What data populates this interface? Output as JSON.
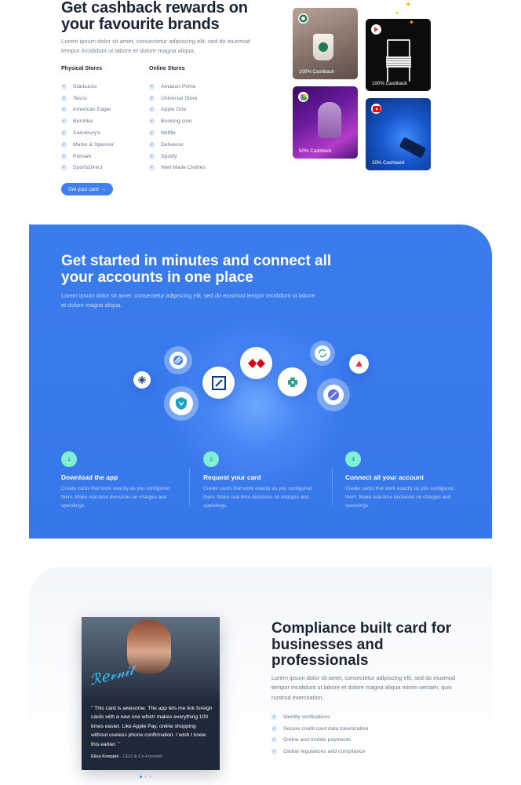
{
  "cashback": {
    "title": "Get cashback rewards on your favourite brands",
    "description": "Lorem ipsum dolor sit amet, consectetur adipiscing elit, sed do eiusmod tempor incididunt ut labore et dolore magna aliqua.",
    "physical_heading": "Physical Stores",
    "online_heading": "Online Stores",
    "physical_stores": [
      "Starbucks",
      "Tesco",
      "American Eagle",
      "Bershka",
      "Sainsbury's",
      "Marks & Spencer",
      "Primark",
      "SportsDirect"
    ],
    "online_stores": [
      "Amazon Prime",
      "Universal Store",
      "Apple One",
      "Booking.com",
      "Netflix",
      "Deliveroo",
      "Spotify",
      "Well Made Clothes"
    ],
    "button_label": "Get your card",
    "button_arrow": "→",
    "tiles": [
      {
        "caption": "100% Cashback",
        "icon": "starbucks-logo-icon"
      },
      {
        "caption": "100% Cashback",
        "icon": "brand-flag-logo-icon"
      },
      {
        "caption": "50% Cashback",
        "icon": "google-photos-logo-icon"
      },
      {
        "caption": "20% Cashback",
        "icon": "youtube-logo-icon"
      }
    ]
  },
  "connect": {
    "title": "Get started in minutes and connect all your accounts in one place",
    "description": "Lorem ipsum dolor sit amet, consectetur adipiscing elit, sed do eiusmod tempor incididunt ut labore et dolore magna aliqua.",
    "steps": [
      {
        "number": "1",
        "title": "Download the app",
        "description": "Create cards that work exactly as you configured them. Make real-time decisions on charges and spendings."
      },
      {
        "number": "2",
        "title": "Request your card",
        "description": "Create cards that work exactly as you configured them. Make real-time decisions on charges and spendings."
      },
      {
        "number": "3",
        "title": "Connect all your account",
        "description": "Create cards that work exactly as you configured them. Make real-time decisions on charges and spendings."
      }
    ],
    "accent_color": "#3b7ced",
    "step_badge_color": "#7ff0d2"
  },
  "compliance": {
    "title": "Compliance built card for businesses and professionals",
    "description": "Lorem ipsum dolor sit amet, consectetur adipiscing elit, sed do eiusmod tempor incididunt ut labore et dolore magna aliqua minim veniam, quis nostrud exercitation.",
    "features": [
      "Identity verifications",
      "Secure credit card data tokenization",
      "Online and mobile payments",
      "Global regulations and compliance"
    ],
    "testimonial": {
      "quote": "\" This card is awesome. The app lets me link foreign cards with a new one which makes everything 100 times easier. Like Apple Pay, online shopping without useless phone confirmation.  I wish I knew this earlier. \"",
      "author": "Elisa Koeppel",
      "role": " - CEO & Co-Founder"
    },
    "carousel_pages": 3,
    "carousel_active": 1
  },
  "check_glyph": "✓"
}
